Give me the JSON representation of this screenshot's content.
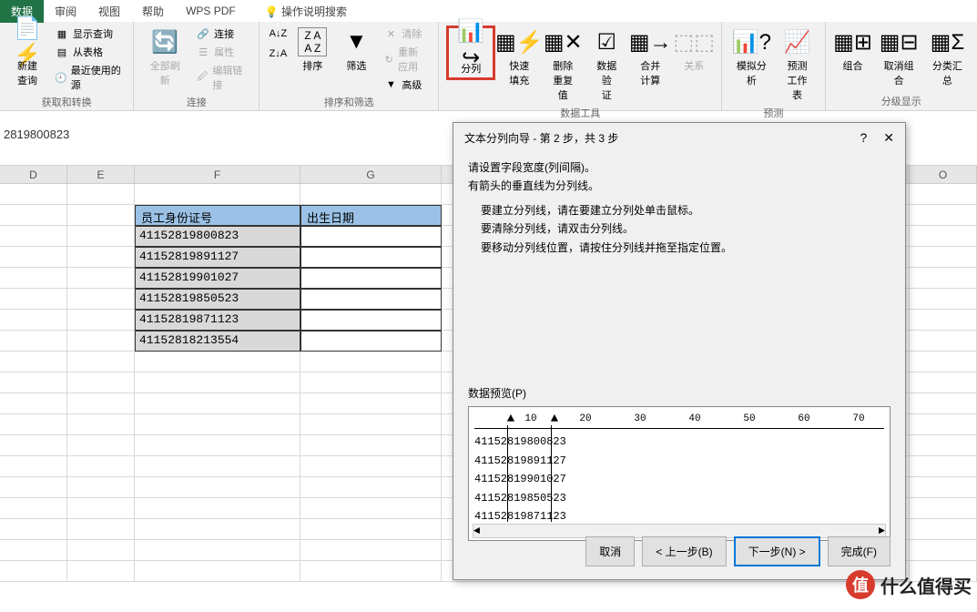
{
  "tabs": {
    "data": "数据",
    "review": "审阅",
    "view": "视图",
    "help": "帮助",
    "wps": "WPS PDF",
    "search": "操作说明搜索"
  },
  "ribbon": {
    "group1": {
      "label": "获取和转换",
      "new_query": "新建\n查询",
      "show_query": "显示查询",
      "from_table": "从表格",
      "recent": "最近使用的源"
    },
    "group2": {
      "label": "连接",
      "refresh": "全部刷新",
      "conn": "连接",
      "prop": "属性",
      "edit": "编辑链接"
    },
    "group3": {
      "label": "排序和筛选",
      "za": "排序",
      "filter": "筛选",
      "clear": "清除",
      "reapply": "重新应用",
      "adv": "高级"
    },
    "group4": {
      "label": "数据工具",
      "split": "分列",
      "flash": "快速填充",
      "dedup": "删除\n重复值",
      "valid": "数据验\n证",
      "consol": "合并计算",
      "rel": "关系"
    },
    "group5": {
      "label": "预测",
      "whatif": "模拟分析",
      "forecast": "预测\n工作表"
    },
    "group6": {
      "label": "分级显示",
      "group": "组合",
      "ungroup": "取消组合",
      "subtotal": "分类汇总"
    }
  },
  "formula": "2819800823",
  "cols": {
    "D": "D",
    "E": "E",
    "F": "F",
    "G": "G",
    "O": "O"
  },
  "table": {
    "header1": "员工身份证号",
    "header2": "出生日期",
    "rows": [
      "41152819800823",
      "41152819891127",
      "41152819901027",
      "41152819850523",
      "41152819871123",
      "41152818213554"
    ]
  },
  "dialog": {
    "title": "文本分列向导 - 第 2 步，共 3 步",
    "line1": "请设置字段宽度(列间隔)。",
    "line2": "有箭头的垂直线为分列线。",
    "hint1": "要建立分列线，请在要建立分列处单击鼠标。",
    "hint2": "要清除分列线，请双击分列线。",
    "hint3": "要移动分列线位置，请按住分列线并拖至指定位置。",
    "preview_label": "数据预览(P)",
    "ticks": [
      "10",
      "20",
      "30",
      "40",
      "50",
      "60",
      "70"
    ],
    "btn_cancel": "取消",
    "btn_back": "< 上一步(B)",
    "btn_next": "下一步(N) >",
    "btn_finish": "完成(F)"
  },
  "chart_data": {
    "type": "table",
    "title": "员工身份证号 / 出生日期",
    "columns": [
      "员工身份证号",
      "出生日期"
    ],
    "rows": [
      [
        "41152819800823",
        ""
      ],
      [
        "41152819891127",
        ""
      ],
      [
        "41152819901027",
        ""
      ],
      [
        "41152819850523",
        ""
      ],
      [
        "41152819871123",
        ""
      ],
      [
        "41152818213554",
        ""
      ]
    ]
  },
  "watermark": "什么值得买"
}
